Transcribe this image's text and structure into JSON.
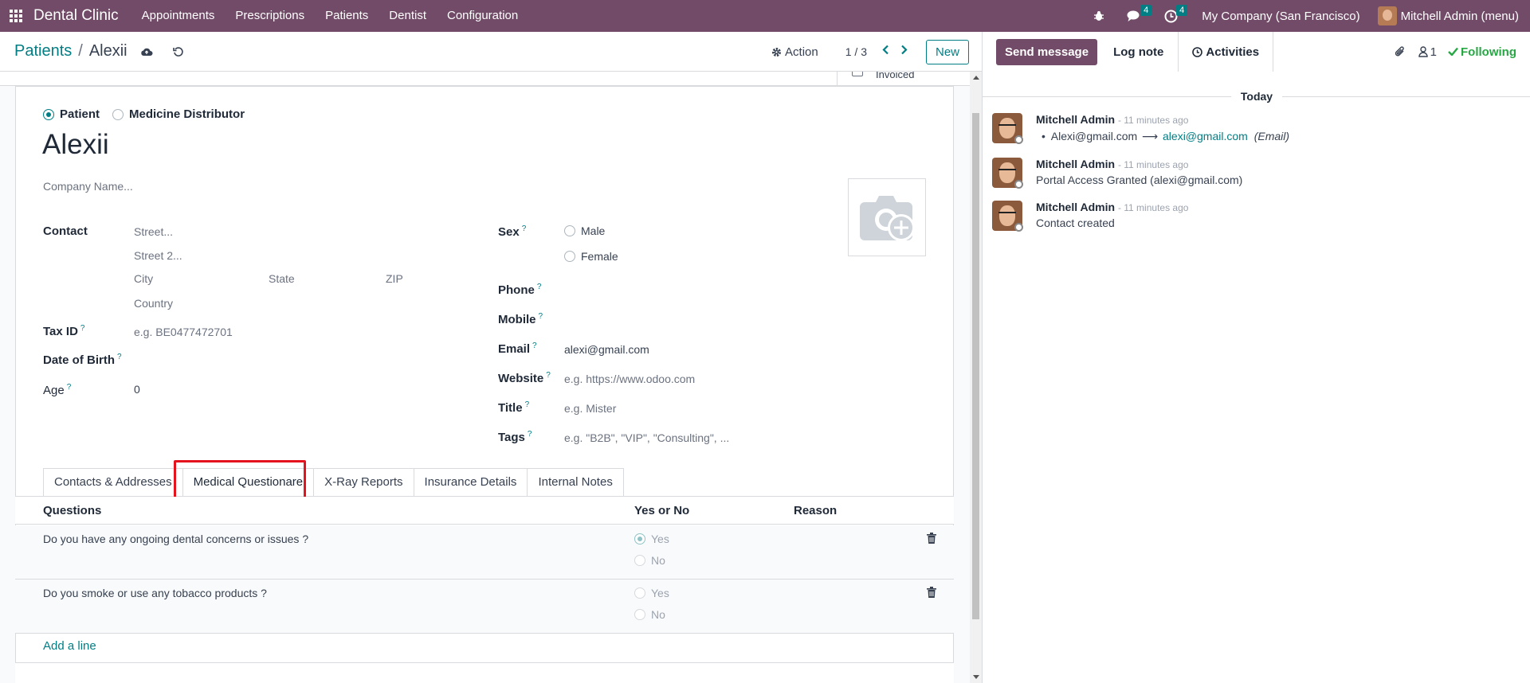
{
  "navbar": {
    "brand": "Dental Clinic",
    "menus": [
      "Appointments",
      "Prescriptions",
      "Patients",
      "Dentist",
      "Configuration"
    ],
    "messages_badge": "4",
    "activities_badge": "4",
    "company": "My Company (San Francisco)",
    "user": "Mitchell Admin (menu)"
  },
  "control": {
    "breadcrumb_root": "Patients",
    "breadcrumb_sep": "/",
    "breadcrumb_current": "Alexii",
    "action_label": "Action",
    "pager": "1 / 3",
    "new_label": "New"
  },
  "form": {
    "invoiced_stub": "Invoiced",
    "type_options": [
      "Patient",
      "Medicine Distributor"
    ],
    "type_selected": "Patient",
    "name": "Alexii",
    "company_placeholder": "Company Name...",
    "contact_label": "Contact",
    "street_ph": "Street...",
    "street2_ph": "Street 2...",
    "city_ph": "City",
    "state_ph": "State",
    "zip_ph": "ZIP",
    "country_ph": "Country",
    "tax_label": "Tax ID",
    "tax_ph": "e.g. BE0477472701",
    "dob_label": "Date of Birth",
    "age_label": "Age",
    "age_value": "0",
    "sex_label": "Sex",
    "sex_options": [
      "Male",
      "Female"
    ],
    "phone_label": "Phone",
    "mobile_label": "Mobile",
    "email_label": "Email",
    "email_value": "alexi@gmail.com",
    "website_label": "Website",
    "website_ph": "e.g. https://www.odoo.com",
    "title_label": "Title",
    "title_ph": "e.g. Mister",
    "tags_label": "Tags",
    "tags_ph": "e.g. \"B2B\", \"VIP\", \"Consulting\", ...",
    "help_mark": "?"
  },
  "tabs": [
    "Contacts & Addresses",
    "Medical Questionare",
    "X-Ray Reports",
    "Insurance Details",
    "Internal Notes"
  ],
  "active_tab": "Medical Questionare",
  "questions": {
    "headers": [
      "Questions",
      "Yes or No",
      "Reason"
    ],
    "rows": [
      {
        "question": "Do you have any ongoing dental concerns or issues ?",
        "yes": "Yes",
        "no": "No",
        "selected": "Yes"
      },
      {
        "question": "Do you smoke or use any tobacco products ?",
        "yes": "Yes",
        "no": "No",
        "selected": ""
      }
    ],
    "add_line": "Add a line"
  },
  "chatter": {
    "send_message": "Send message",
    "log_note": "Log note",
    "activities": "Activities",
    "followers_count": "1",
    "following": "Following",
    "today": "Today",
    "messages": [
      {
        "author": "Mitchell Admin",
        "time": "- 11 minutes ago",
        "old_value": "Alexi@gmail.com",
        "new_value": "alexi@gmail.com",
        "field": "(Email)"
      },
      {
        "author": "Mitchell Admin",
        "time": "- 11 minutes ago",
        "body": "Portal Access Granted (alexi@gmail.com)"
      },
      {
        "author": "Mitchell Admin",
        "time": "- 11 minutes ago",
        "body": "Contact created"
      }
    ]
  },
  "colors": {
    "brand": "#714b67",
    "accent": "#017e84",
    "highlight": "#e4131e",
    "following": "#28a745"
  }
}
